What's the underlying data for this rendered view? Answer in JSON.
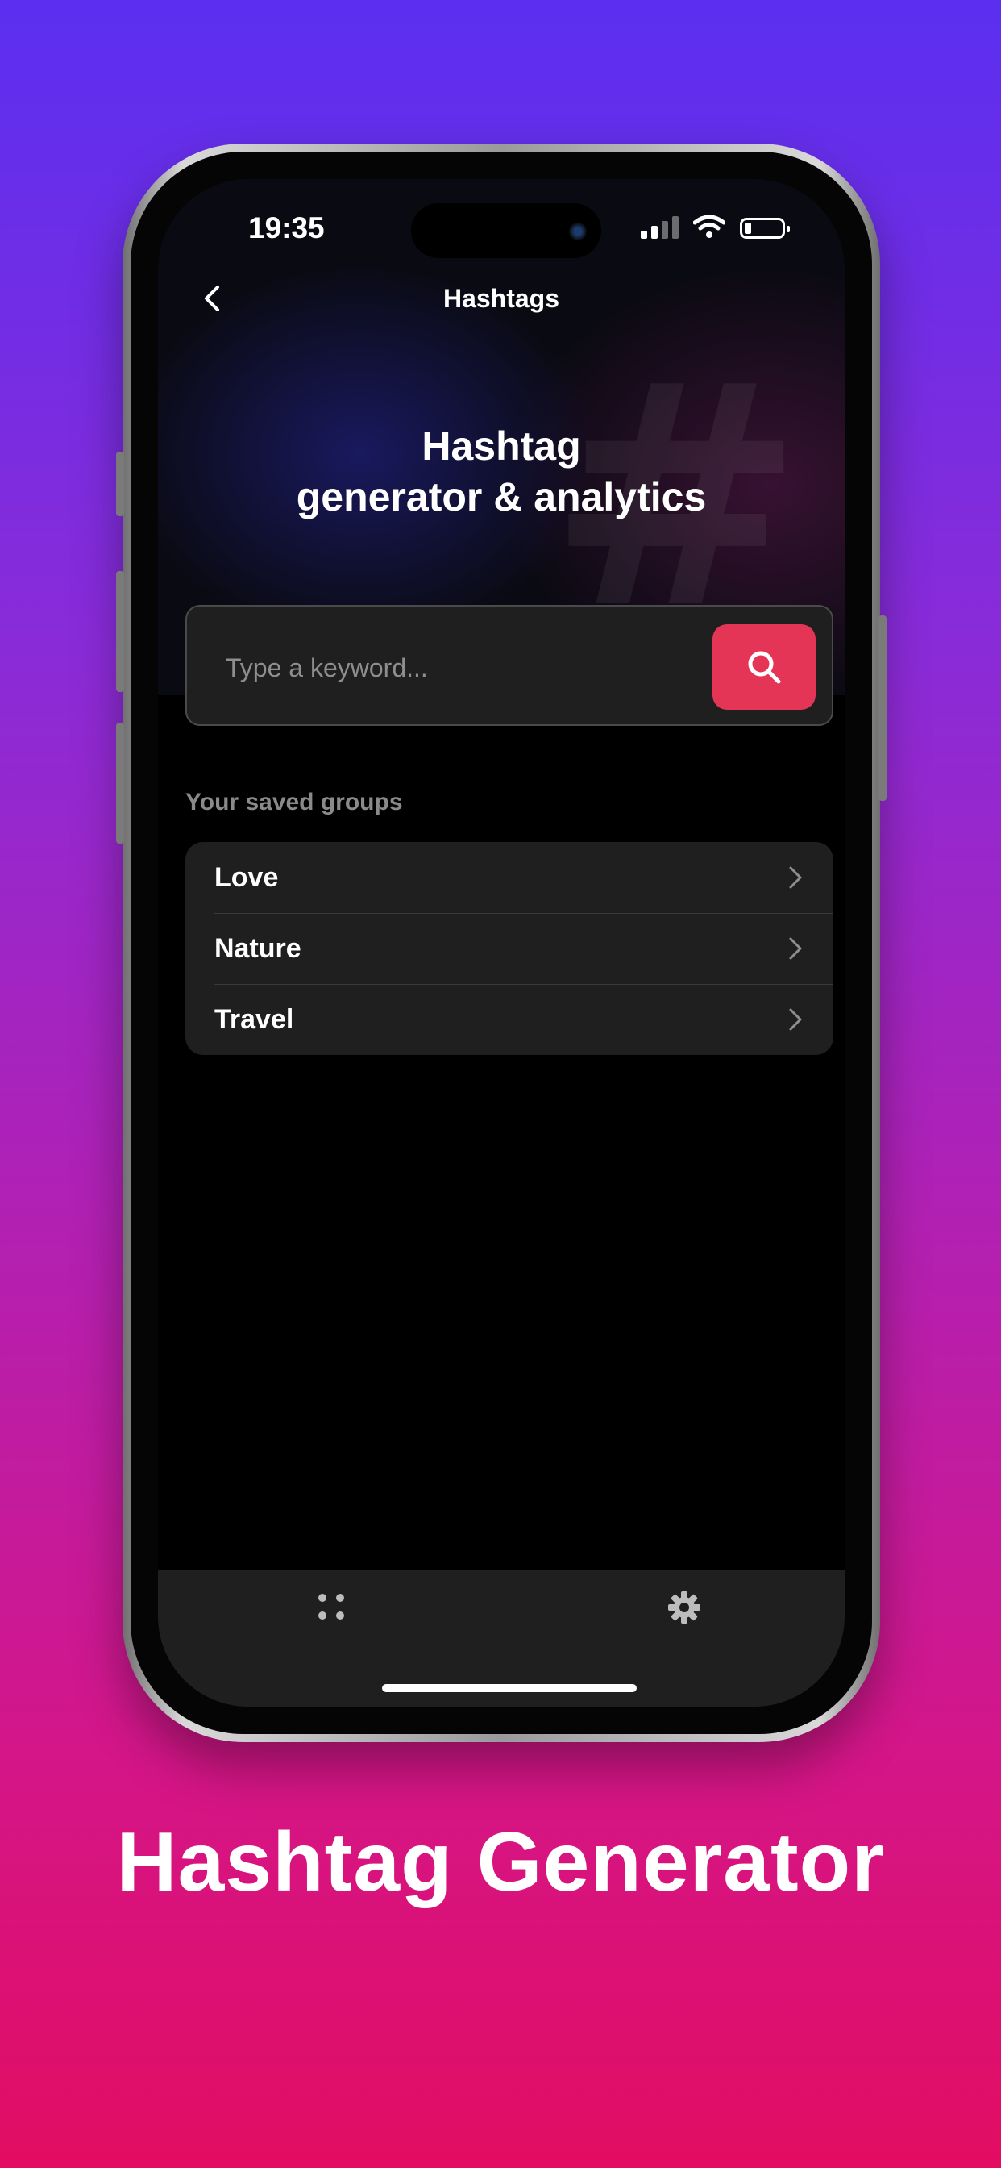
{
  "status_bar": {
    "time": "19:35"
  },
  "nav": {
    "title": "Hashtags"
  },
  "hero": {
    "line1": "Hashtag",
    "line2": "generator & analytics",
    "watermark": "#"
  },
  "search": {
    "placeholder": "Type a keyword...",
    "value": ""
  },
  "saved_groups": {
    "label": "Your saved groups",
    "items": [
      {
        "label": "Love"
      },
      {
        "label": "Nature"
      },
      {
        "label": "Travel"
      }
    ]
  },
  "tabbar": {
    "icons": [
      "grid-icon",
      "gear-icon"
    ]
  },
  "caption": "Hashtag Generator",
  "colors": {
    "accent": "#e43557",
    "card": "#1f1f1f",
    "background": "#000000"
  }
}
